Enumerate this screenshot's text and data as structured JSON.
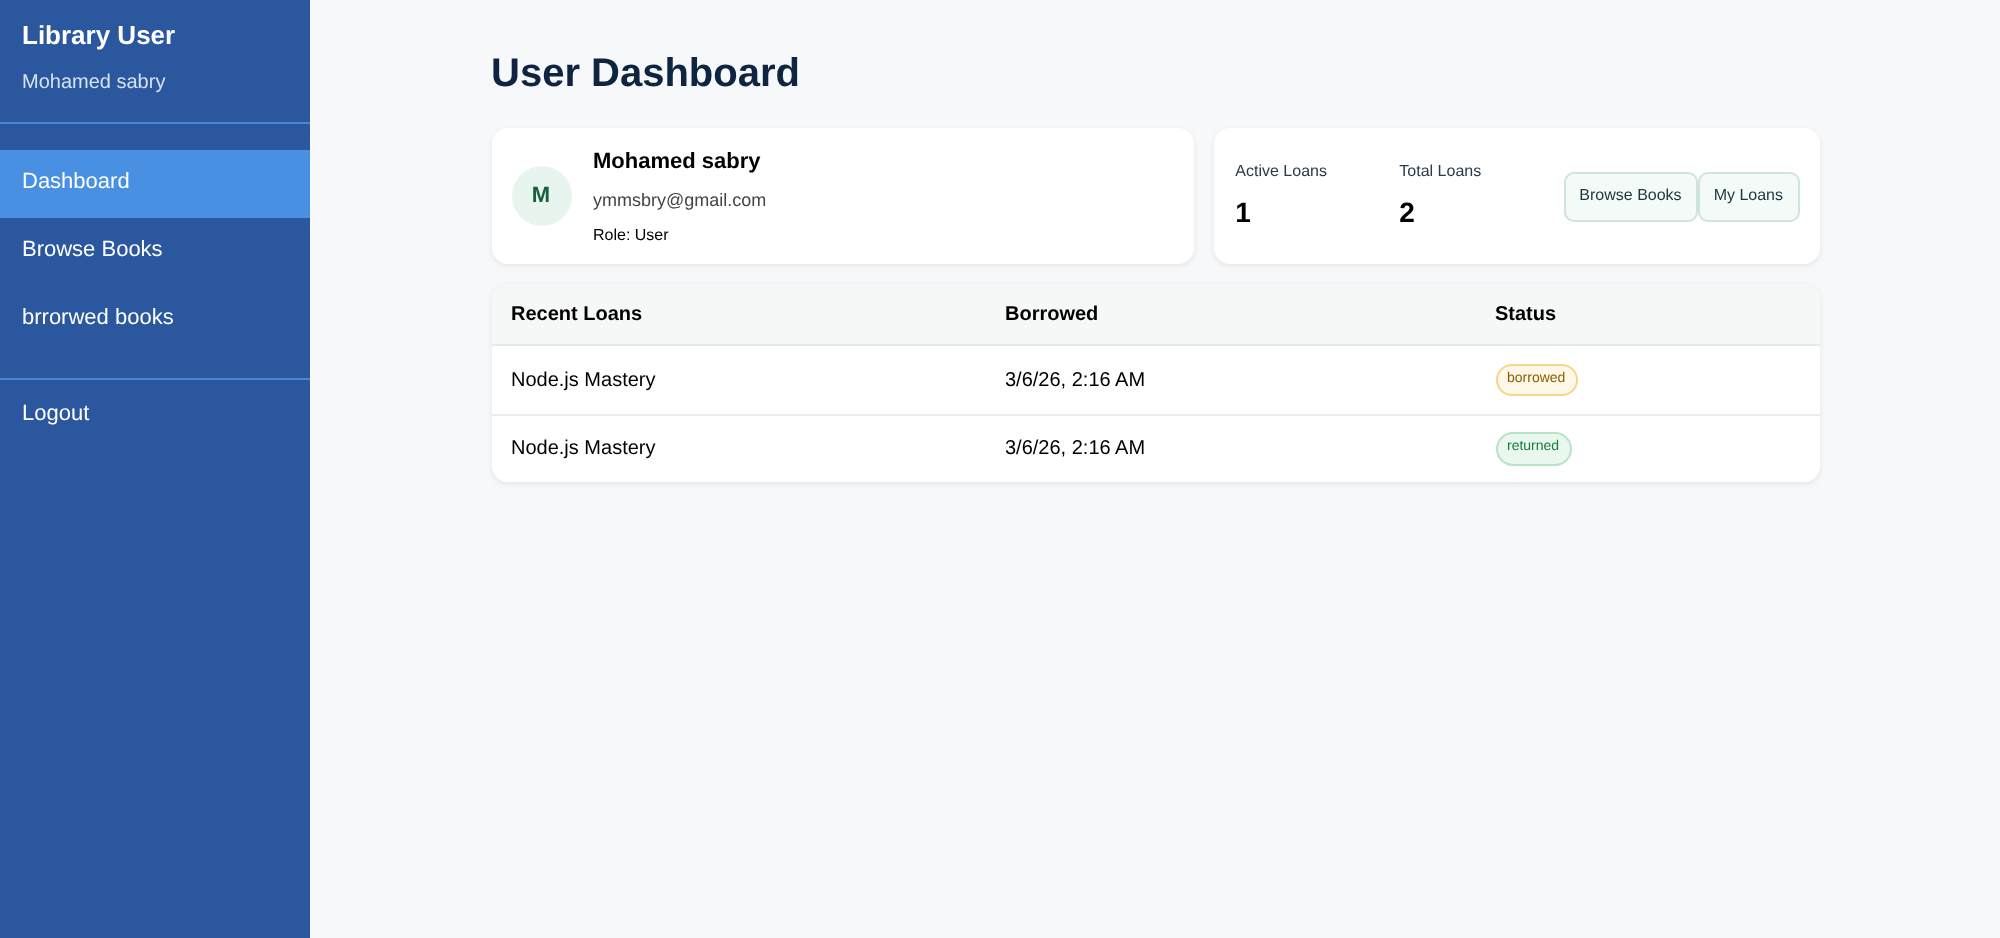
{
  "sidebar": {
    "title": "Library User",
    "subtitle": "Mohamed sabry",
    "items": [
      {
        "label": "Dashboard",
        "selected": true
      },
      {
        "label": "Browse Books",
        "selected": false
      },
      {
        "label": "brrorwed books",
        "selected": false
      }
    ],
    "logout": "Logout"
  },
  "page_title": "User Dashboard",
  "profile": {
    "initial": "M",
    "name": "Mohamed sabry",
    "email": "ymmsbry@gmail.com",
    "role": "Role: User"
  },
  "stats": [
    {
      "label": "Active Loans",
      "value": "1"
    },
    {
      "label": "Total Loans",
      "value": "2"
    }
  ],
  "actions": [
    "Browse Books",
    "My Loans"
  ],
  "table": {
    "columns": [
      "Recent Loans",
      "Borrowed",
      "Status"
    ],
    "rows": [
      {
        "book": "Node.js Mastery",
        "borrowed": "3/6/26, 2:16 AM",
        "status": "borrowed",
        "kind": "borrowed"
      },
      {
        "book": "Node.js Mastery",
        "borrowed": "3/6/26, 2:16 AM",
        "status": "returned",
        "kind": "returned"
      }
    ]
  }
}
